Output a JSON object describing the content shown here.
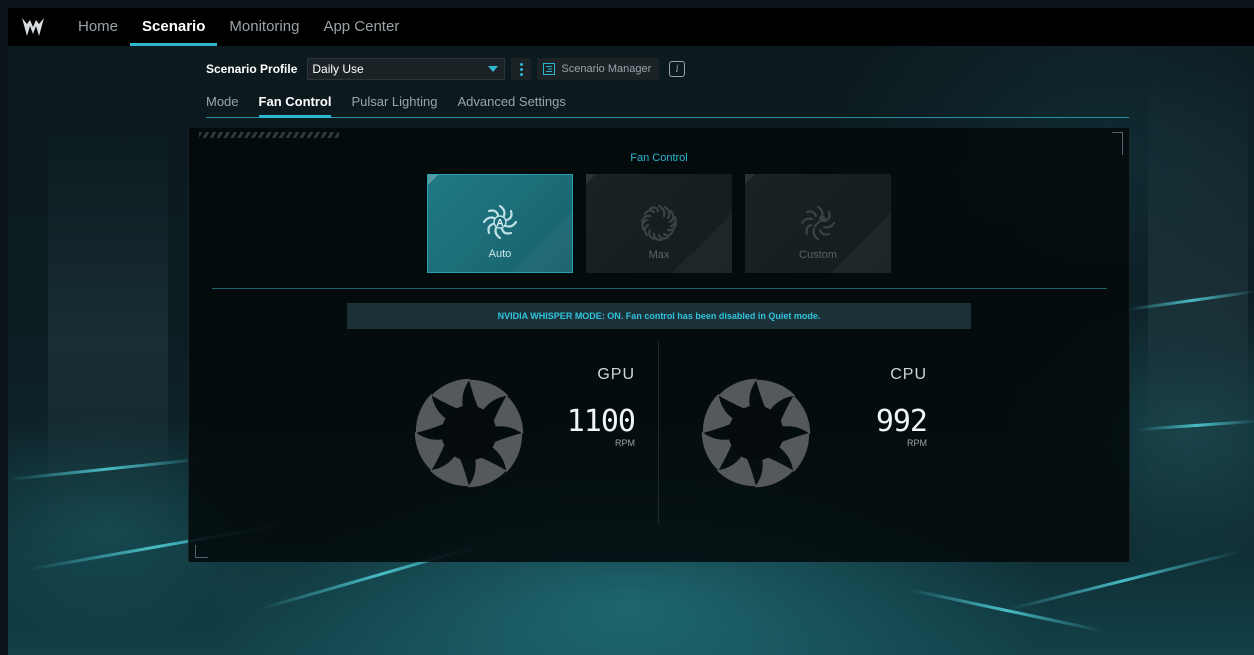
{
  "nav": {
    "items": [
      {
        "label": "Home",
        "active": false
      },
      {
        "label": "Scenario",
        "active": true
      },
      {
        "label": "Monitoring",
        "active": false
      },
      {
        "label": "App Center",
        "active": false
      }
    ]
  },
  "profile": {
    "label": "Scenario Profile",
    "selected": "Daily Use",
    "manager_label": "Scenario Manager",
    "info_glyph": "i"
  },
  "subtabs": [
    {
      "label": "Mode",
      "active": false
    },
    {
      "label": "Fan Control",
      "active": true
    },
    {
      "label": "Pulsar Lighting",
      "active": false
    },
    {
      "label": "Advanced Settings",
      "active": false
    }
  ],
  "fan_control": {
    "title": "Fan Control",
    "modes": [
      {
        "label": "Auto",
        "icon": "fan-auto-icon",
        "selected": true
      },
      {
        "label": "Max",
        "icon": "fan-max-icon",
        "selected": false
      },
      {
        "label": "Custom",
        "icon": "fan-custom-icon",
        "selected": false
      }
    ],
    "notice": "NVIDIA WHISPER MODE: ON. Fan control has been disabled in Quiet mode."
  },
  "fans": {
    "gpu": {
      "name": "GPU",
      "rpm": "1100",
      "unit": "RPM"
    },
    "cpu": {
      "name": "CPU",
      "rpm": "992",
      "unit": "RPM"
    }
  },
  "colors": {
    "accent": "#2fb6cf",
    "active_card": "#1b6b76",
    "notice_bg": "#1d3138",
    "nav_bg": "#000000"
  }
}
